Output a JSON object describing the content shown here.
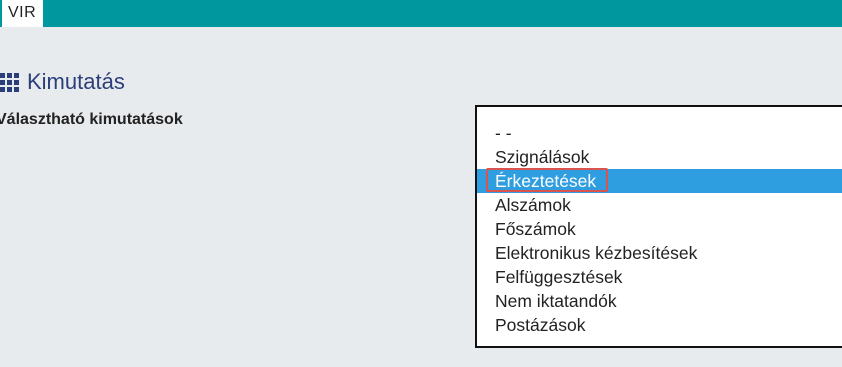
{
  "header": {
    "app_name": "VIR"
  },
  "page": {
    "title": "Kimutatás",
    "title_icon": "grid-icon"
  },
  "reports": {
    "label": "Választható kimutatások",
    "options": [
      "- -",
      "Szignálások",
      "Érkeztetések",
      "Alszámok",
      "Főszámok",
      "Elektronikus kézbesítések",
      "Felfüggesztések",
      "Nem iktatandók",
      "Postázások"
    ],
    "selected_index": 2
  },
  "colors": {
    "topbar": "#00979f",
    "selection": "#2e9ee0",
    "highlight_border": "#d9534f",
    "title": "#2c3e7a"
  }
}
